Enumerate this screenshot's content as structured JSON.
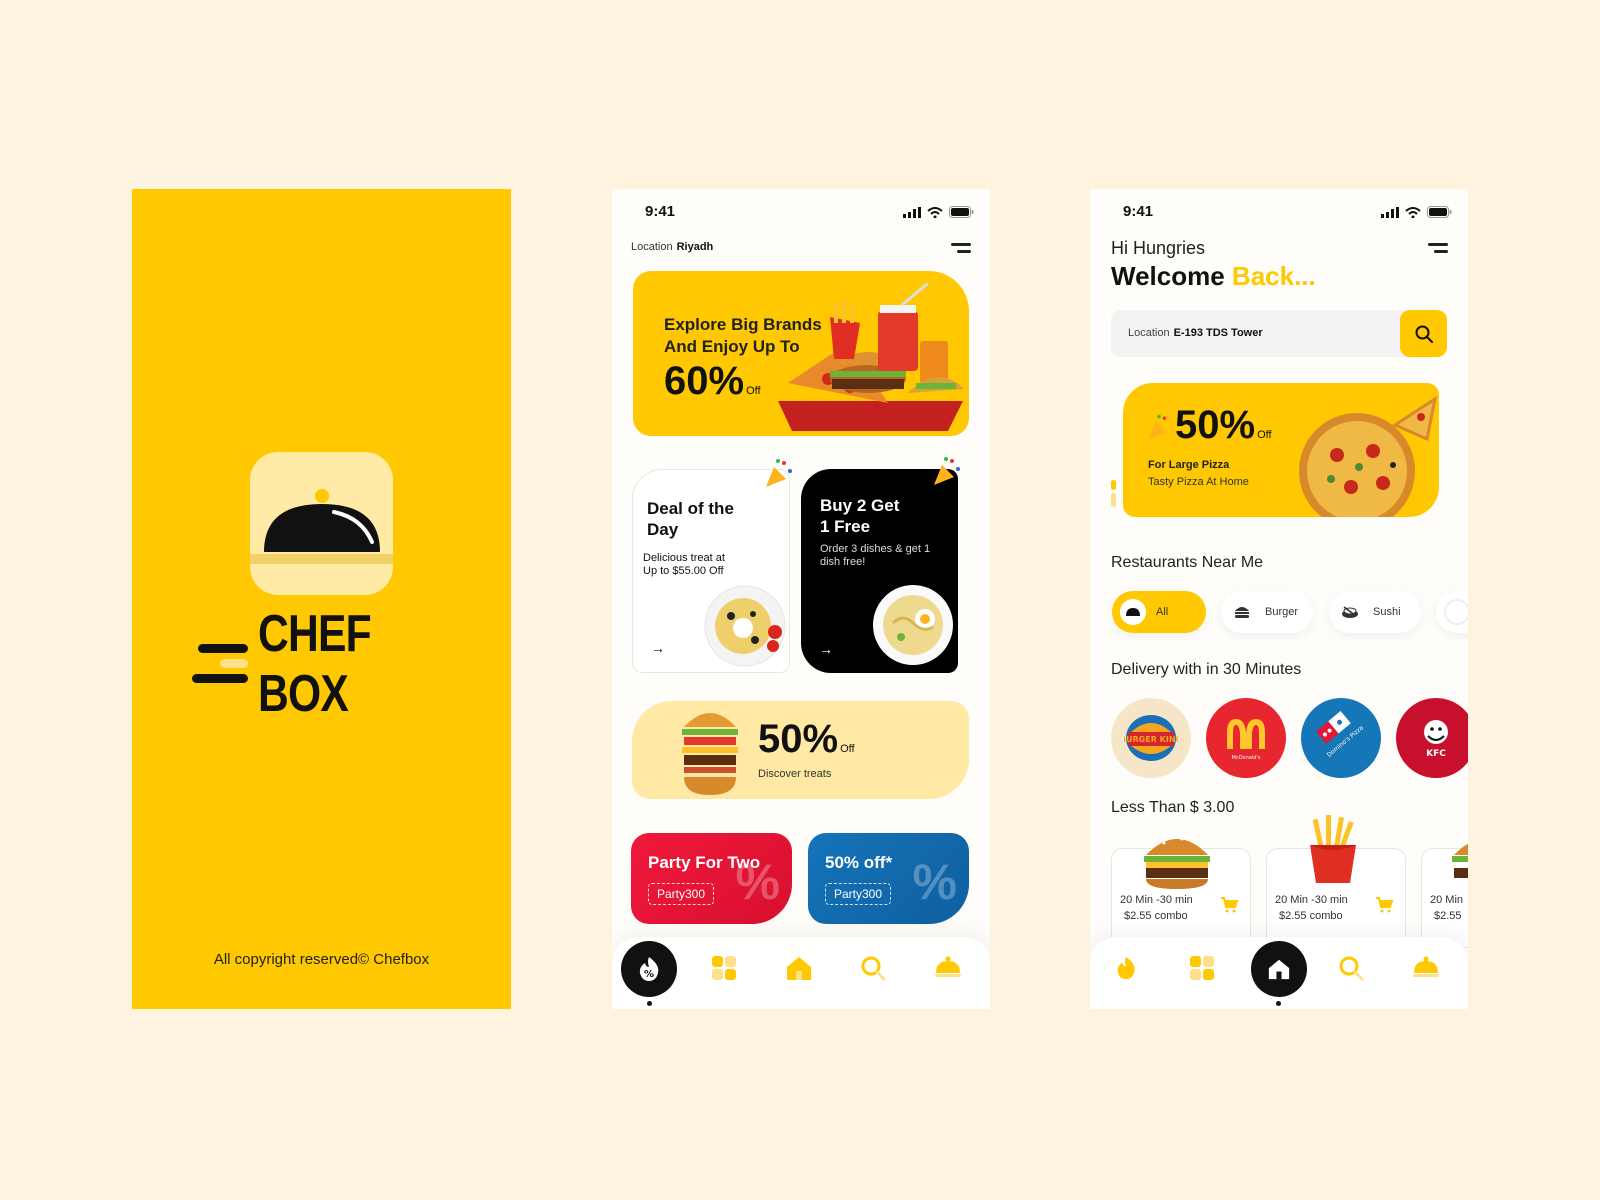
{
  "splash": {
    "brand_name": "CHEF BOX",
    "copyright": "All copyright reserved© Chefbox",
    "colors": {
      "background": "#ffc800",
      "tile": "#ffeaa6",
      "dark": "#111111"
    }
  },
  "deals_screen": {
    "status_time": "9:41",
    "location_label": "Location",
    "location_value": "Riyadh",
    "banner1": {
      "line1": "Explore Big Brands",
      "line2": "And Enjoy Up To",
      "percent": "60%",
      "off": "Off"
    },
    "deal_of_day": {
      "title_line1": "Deal of the",
      "title_line2": "Day",
      "sub_line1": "Delicious treat at",
      "sub_line2": "Up to $55.00 Off",
      "arrow": "→"
    },
    "buy2": {
      "title_line1": "Buy 2 Get",
      "title_line2": "1 Free",
      "sub_line1": "Order 3 dishes & get 1",
      "sub_line2": "dish free!",
      "arrow": "→"
    },
    "banner2": {
      "percent": "50%",
      "off": "Off",
      "subtitle": "Discover treats"
    },
    "promo1": {
      "title": "Party For Two",
      "code": "Party300",
      "symbol": "%"
    },
    "promo2": {
      "title": "50% off*",
      "code": "Party300",
      "symbol": "%"
    },
    "tabs": [
      "offers-icon",
      "categories-icon",
      "home-icon",
      "search-icon",
      "cloche-icon"
    ],
    "active_tab": "offers-icon"
  },
  "home_screen": {
    "status_time": "9:41",
    "greeting": "Hi Hungries",
    "welcome_word": "Welcome",
    "welcome_accent": "Back...",
    "search": {
      "label": "Location",
      "value": "E-193 TDS Tower"
    },
    "pizza_banner": {
      "percent": "50%",
      "off": "Off",
      "line1": "For Large Pizza",
      "line2": "Tasty Pizza At Home"
    },
    "restaurants_title": "Restaurants Near Me",
    "chips": [
      {
        "label": "All",
        "icon": "cloche-icon",
        "active": true
      },
      {
        "label": "Burger",
        "icon": "burger-icon",
        "active": false
      },
      {
        "label": "Sushi",
        "icon": "sushi-icon",
        "active": false
      }
    ],
    "delivery_title": "Delivery with in 30 Minutes",
    "brands": [
      {
        "name": "Burger King",
        "logo_text": "BURGER KING",
        "color": "#f5e6c8"
      },
      {
        "name": "McDonald's",
        "logo_text": "McDonald's",
        "color": "#e8262f"
      },
      {
        "name": "Domino's Pizza",
        "logo_text": "Domino's Pizza",
        "color": "#1576b8"
      },
      {
        "name": "KFC",
        "logo_text": "KFC",
        "color": "#c8102e"
      }
    ],
    "cheap_title": "Less Than $ 3.00",
    "cheap_items": [
      {
        "time": "20 Min -30 min",
        "price": "$2.55 combo",
        "image": "burger"
      },
      {
        "time": "20 Min -30 min",
        "price": "$2.55 combo",
        "image": "fries"
      },
      {
        "time": "20 Min",
        "price": "$2.55",
        "image": "burger"
      }
    ],
    "active_tab": "home-icon"
  },
  "accent_color": "#ffc800"
}
